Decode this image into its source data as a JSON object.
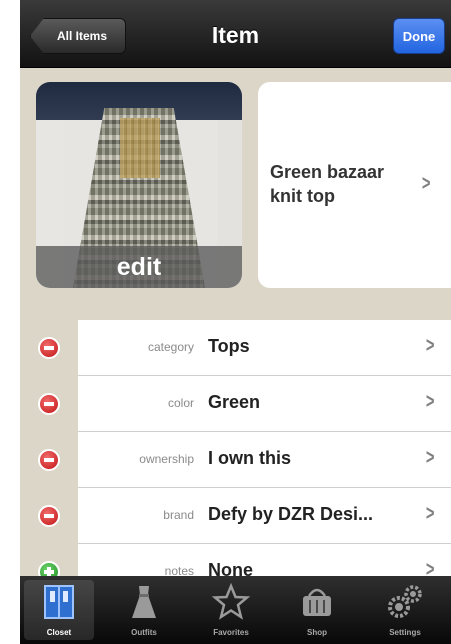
{
  "nav": {
    "back_label": "All Items",
    "title": "Item",
    "done_label": "Done"
  },
  "photo": {
    "edit_label": "edit"
  },
  "item": {
    "name": "Green bazaar knit top"
  },
  "attributes": [
    {
      "label": "category",
      "value": "Tops",
      "action": "remove"
    },
    {
      "label": "color",
      "value": "Green",
      "action": "remove"
    },
    {
      "label": "ownership",
      "value": "I own this",
      "action": "remove"
    },
    {
      "label": "brand",
      "value": "Defy by DZR Desi...",
      "action": "remove"
    },
    {
      "label": "notes",
      "value": "None",
      "action": "add"
    }
  ],
  "tabs": [
    {
      "label": "Closet",
      "icon": "closet-icon",
      "active": true
    },
    {
      "label": "Outfits",
      "icon": "dress-icon",
      "active": false
    },
    {
      "label": "Favorites",
      "icon": "star-icon",
      "active": false
    },
    {
      "label": "Shop",
      "icon": "basket-icon",
      "active": false
    },
    {
      "label": "Settings",
      "icon": "gears-icon",
      "active": false
    }
  ],
  "colors": {
    "done_blue": "#2265e0",
    "remove_red": "#c21515",
    "add_green": "#1e8f1e",
    "background": "#dcd6c9"
  }
}
